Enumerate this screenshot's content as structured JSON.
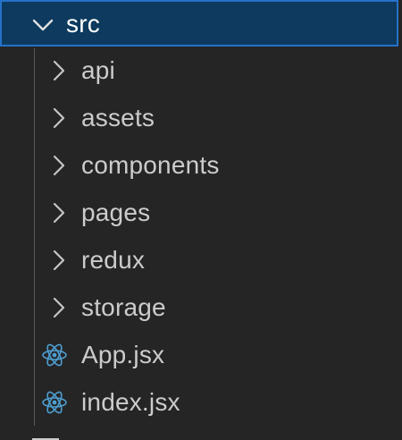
{
  "explorer": {
    "root": {
      "label": "src",
      "expanded": true,
      "icon": "chevron-down-icon"
    },
    "folders": [
      {
        "label": "api",
        "icon": "chevron-right-icon"
      },
      {
        "label": "assets",
        "icon": "chevron-right-icon"
      },
      {
        "label": "components",
        "icon": "chevron-right-icon"
      },
      {
        "label": "pages",
        "icon": "chevron-right-icon"
      },
      {
        "label": "redux",
        "icon": "chevron-right-icon"
      },
      {
        "label": "storage",
        "icon": "chevron-right-icon"
      }
    ],
    "files": [
      {
        "label": "App.jsx",
        "icon": "react-icon"
      },
      {
        "label": "index.jsx",
        "icon": "react-icon"
      }
    ]
  },
  "colors": {
    "background": "#252526",
    "selection_bg": "#0d3a5e",
    "selection_border": "#2472c8",
    "text": "#cccccc",
    "react_icon": "#4e9fd1"
  }
}
